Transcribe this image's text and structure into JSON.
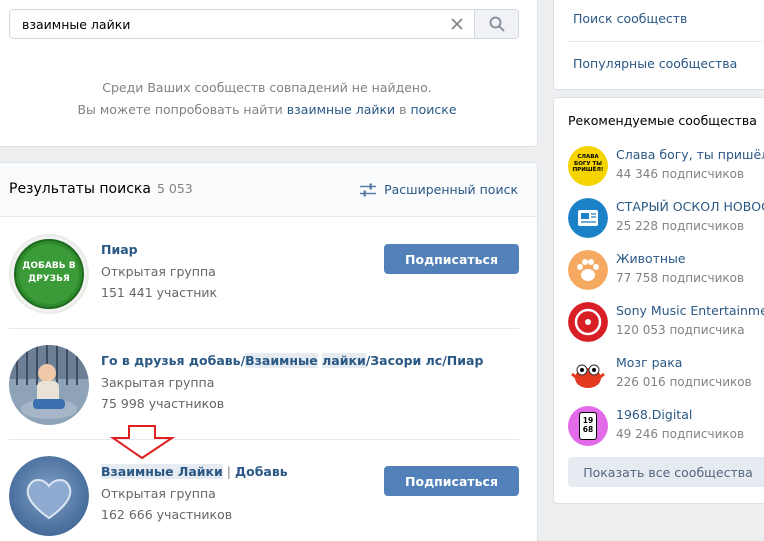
{
  "search": {
    "query": "взаимные лайки",
    "clear_icon": "close-icon",
    "search_icon": "search-icon"
  },
  "not_found": {
    "line1": "Среди Ваших сообществ совпадений не найдено.",
    "line2_prefix": "Вы можете попробовать найти ",
    "line2_link": "взаимные лайки",
    "line2_mid": " в ",
    "line2_link2": "поиске"
  },
  "results": {
    "title": "Результаты поиска",
    "count": "5 053",
    "advanced_label": "Расширенный поиск",
    "groups": [
      {
        "name_parts": [
          "Пиар"
        ],
        "type": "Открытая группа",
        "members": "151 441 участник",
        "button": "Подписаться",
        "avatar_text": "ДОБАВЬ В ДРУЗЬЯ"
      },
      {
        "name_p1": "Го в друзья добавь/",
        "name_hl1": "Взаимные",
        "name_p2": " ",
        "name_hl2": "лайки",
        "name_p3": "/Засори лс/Пиар",
        "type": "Закрытая группа",
        "members": "75 998 участников"
      },
      {
        "name_hl1": "Взаимные",
        "name_p2": " ",
        "name_hl2": "Лайки",
        "name_sep": " | ",
        "name_p3": "Добавь",
        "type": "Открытая группа",
        "members": "162 666 участников",
        "button": "Подписаться"
      }
    ]
  },
  "right_menu": {
    "search_communities": "Поиск сообществ",
    "popular_communities": "Популярные сообщества"
  },
  "recommended": {
    "title": "Рекомендуемые сообщества",
    "items": [
      {
        "name": "Слава богу, ты пришёл!",
        "subs": "44 346 подписчиков",
        "avatar_text": "СЛАВА БОГУ ТЫ ПРИШЁЛ!"
      },
      {
        "name": "СТАРЫЙ ОСКОЛ НОВОСТИ",
        "subs": "25 228 подписчиков"
      },
      {
        "name": "Животные",
        "subs": "77 758 подписчиков"
      },
      {
        "name": "Sony Music Entertainment",
        "subs": "120 053 подписчика"
      },
      {
        "name": "Мозг рака",
        "subs": "226 016 подписчиков"
      },
      {
        "name": "1968.Digital",
        "subs": "49 246 подписчиков",
        "avatar_text": "19 68"
      }
    ],
    "show_all": "Показать все сообщества"
  },
  "colors": {
    "link": "#2a5885",
    "button": "#5181b8",
    "muted": "#828282",
    "arrow": "#e02020"
  }
}
